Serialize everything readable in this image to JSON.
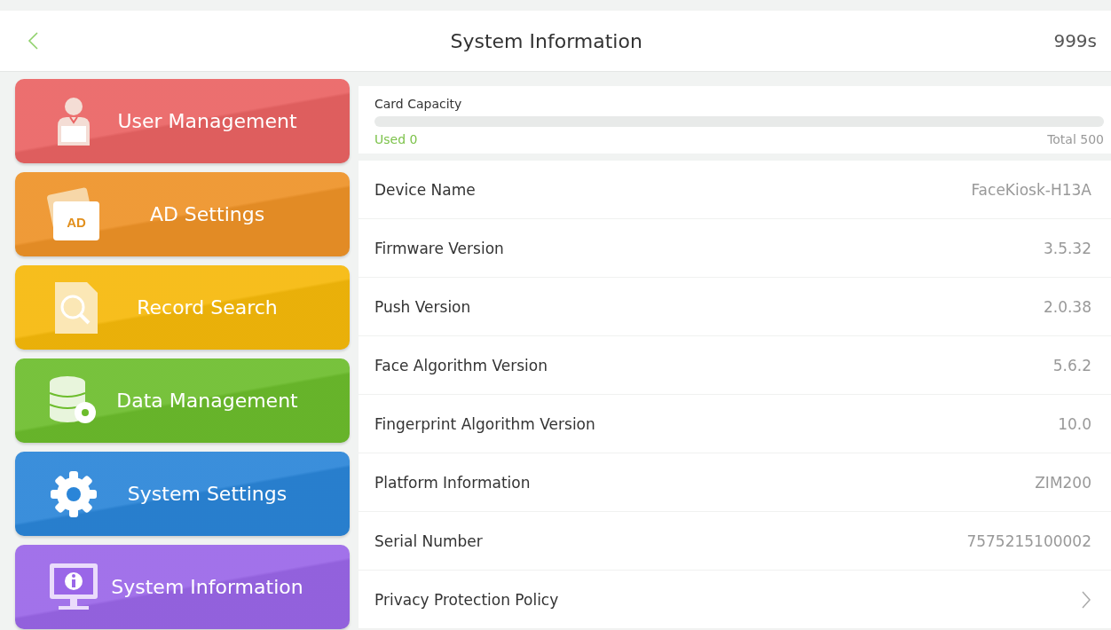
{
  "header": {
    "title": "System Information",
    "countdown": "999s"
  },
  "menu": [
    {
      "label": "User Management",
      "kind": "user",
      "color": "#ea6363"
    },
    {
      "label": "AD Settings",
      "kind": "ad",
      "color": "#ee9227",
      "badge": "AD"
    },
    {
      "label": "Record Search",
      "kind": "search",
      "color": "#f6b90a"
    },
    {
      "label": "Data Management",
      "kind": "data",
      "color": "#6cbd2c"
    },
    {
      "label": "System Settings",
      "kind": "settings",
      "color": "#2a85d8"
    },
    {
      "label": "System Information",
      "kind": "info",
      "color": "#9a66e8"
    }
  ],
  "capacity": {
    "title": "Card Capacity",
    "level": 0,
    "used": "Used 0",
    "total": "Total 500"
  },
  "rows": [
    {
      "label": "Device Name",
      "value": "FaceKiosk-H13A"
    },
    {
      "label": "Firmware Version",
      "value": "3.5.32"
    },
    {
      "label": "Push Version",
      "value": "2.0.38"
    },
    {
      "label": "Face Algorithm Version",
      "value": "5.6.2"
    },
    {
      "label": "Fingerprint Algorithm Version",
      "value": "10.0"
    },
    {
      "label": "Platform Information",
      "value": "ZIM200"
    },
    {
      "label": "Serial Number",
      "value": "7575215100002"
    },
    {
      "label": "Privacy Protection Policy",
      "kind": "link"
    }
  ]
}
